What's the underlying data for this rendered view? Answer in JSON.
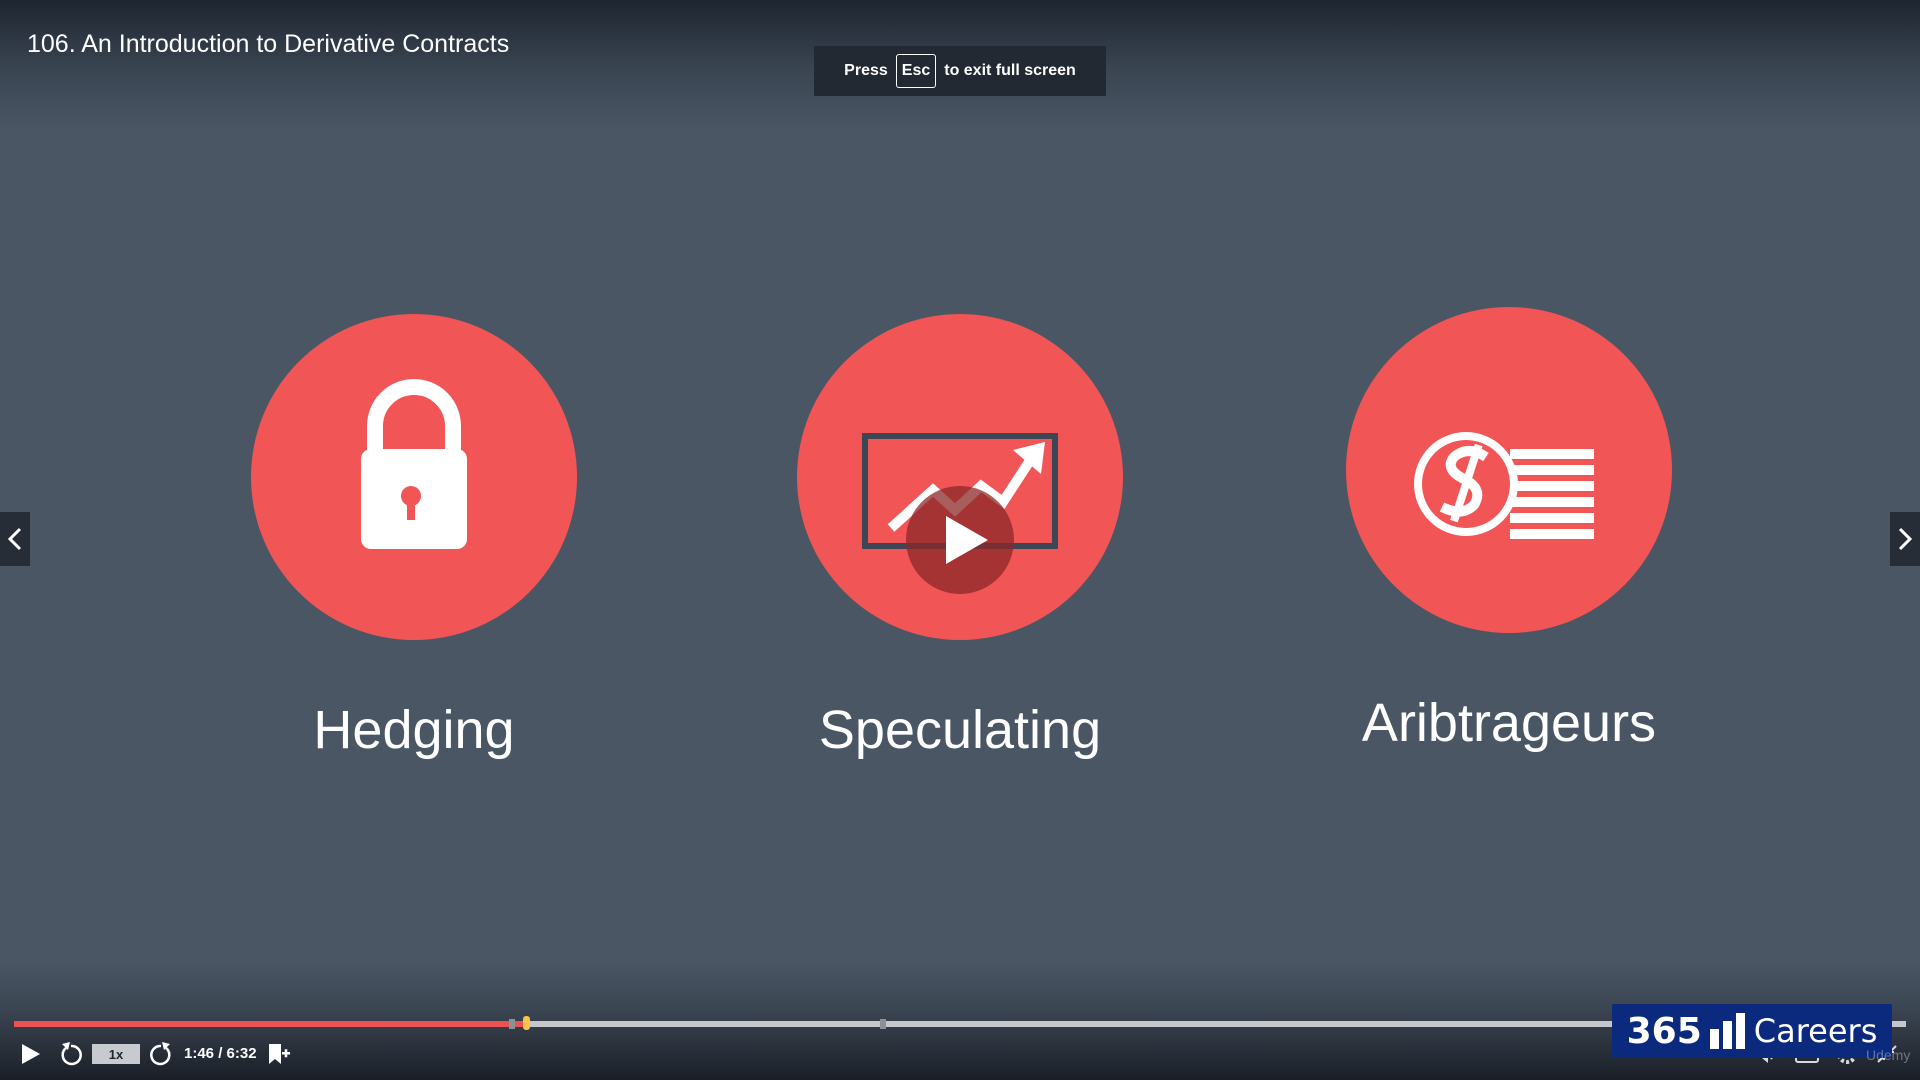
{
  "lecture": {
    "title": "106. An Introduction to Derivative Contracts"
  },
  "fullscreen_toast": {
    "prefix": "Press",
    "key": "Esc",
    "suffix": "to exit full screen"
  },
  "slide": {
    "topics": [
      {
        "label": "Hedging",
        "icon": "lock-icon"
      },
      {
        "label": "Speculating",
        "icon": "rising-chart-icon"
      },
      {
        "label": "Aribtrageurs",
        "icon": "dollar-coin-stack-icon"
      }
    ],
    "accent_color": "#f25556",
    "background_color": "#4a5664"
  },
  "player": {
    "speed_label": "1x",
    "time_display": "1:46 / 6:32",
    "progress": {
      "current_seconds": 106,
      "total_seconds": 392
    },
    "progress_color": "#ec5252",
    "icons": [
      "play-icon",
      "rewind-icon",
      "forward-icon",
      "bookmark-add-icon",
      "volume-icon",
      "captions-icon",
      "settings-icon",
      "exit-fullscreen-icon"
    ]
  },
  "brand": {
    "number": "365",
    "word": "Careers",
    "color": "#0b2a7e"
  },
  "watermark": "Udemy"
}
